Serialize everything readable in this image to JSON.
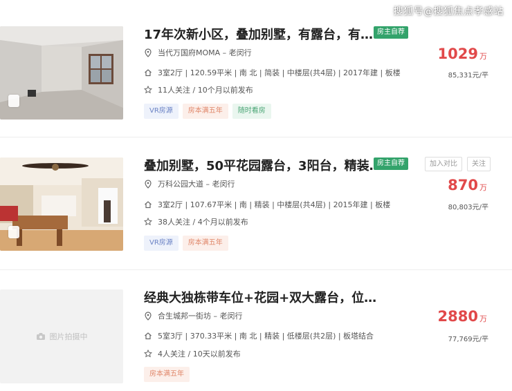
{
  "watermark": "搜狐号@搜狐焦点孝感站",
  "colors": {
    "price": "#e1494a",
    "owner_badge": "#33a36b"
  },
  "listings": [
    {
      "title": "17年次新小区，叠加别墅，有露台，有…",
      "badge": "房主自荐",
      "location": "当代万国府MOMA – 老闵行",
      "details": "3室2厅 | 120.59平米 | 南 北 | 简装 | 中楼层(共4层) | 2017年建 | 板楼",
      "follow": "11人关注 / 10个月以前发布",
      "tags": [
        "VR房源",
        "房本满五年",
        "随时看房"
      ],
      "price": "1029",
      "price_unit": "万",
      "unit_price": "85,331元/平",
      "photo": "empty-room-photo"
    },
    {
      "title": "叠加别墅，50平花园露台，3阳台，精装…",
      "badge": "房主自荐",
      "location": "万科公园大道 – 老闵行",
      "details": "3室2厅 | 107.67平米 | 南 | 精装 | 中楼层(共4层) | 2015年建 | 板楼",
      "follow": "38人关注 / 4个月以前发布",
      "tags": [
        "VR房源",
        "房本满五年"
      ],
      "price": "870",
      "price_unit": "万",
      "unit_price": "80,803元/平",
      "compare_label": "加入对比",
      "follow_label": "关注",
      "photo": "dining-room-photo"
    },
    {
      "title": "经典大独栋带车位+花园+双大露台，位…",
      "location": "合生城邦一街坊 – 老闵行",
      "details": "5室3厅 | 370.33平米 | 南 北 | 精装 | 低楼层(共2层) | 板塔结合",
      "follow": "4人关注 / 10天以前发布",
      "tags": [
        "房本满五年"
      ],
      "price": "2880",
      "price_unit": "万",
      "unit_price": "77,769元/平",
      "photo_placeholder": "图片拍摄中"
    }
  ]
}
